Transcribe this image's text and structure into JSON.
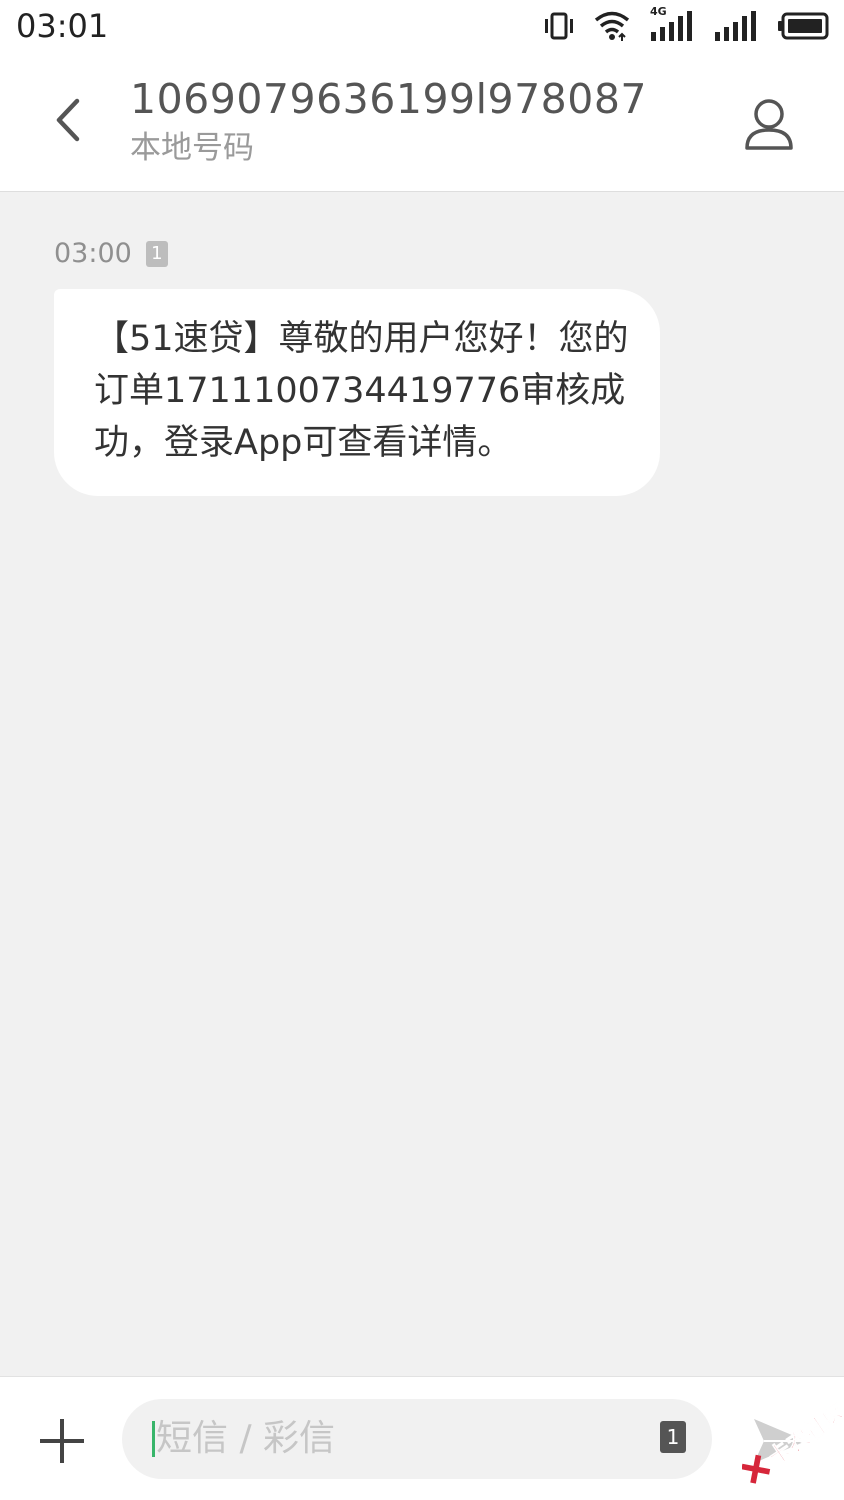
{
  "status_bar": {
    "time": "03:01",
    "network_label": "4G",
    "icons": [
      "vibrate-icon",
      "wifi-icon",
      "cellular-4g-icon",
      "cellular-signal-icon",
      "battery-icon"
    ]
  },
  "header": {
    "back_icon": "back-arrow-icon",
    "contact_number": "1069079636199l978087",
    "contact_subtitle": "本地号码",
    "contact_icon": "person-icon"
  },
  "conversation": {
    "messages": [
      {
        "time": "03:00",
        "sim": "1",
        "text": "【51速贷】尊敬的用户您好！您的订单1711100734419776审核成功，登录App可查看详情。"
      }
    ]
  },
  "composer": {
    "attach_icon": "plus-icon",
    "placeholder": "短信 / 彩信",
    "sim": "1",
    "send_icon": "send-icon",
    "accent_color": "#38b56a"
  },
  "watermark": {
    "text": "卡农社区",
    "color": "#d6263a"
  },
  "colors": {
    "background": "#f1f1f1",
    "header_background": "#ffffff",
    "bubble_background": "#ffffff",
    "primary_text": "#333333",
    "secondary_text": "#9a9a9a"
  }
}
